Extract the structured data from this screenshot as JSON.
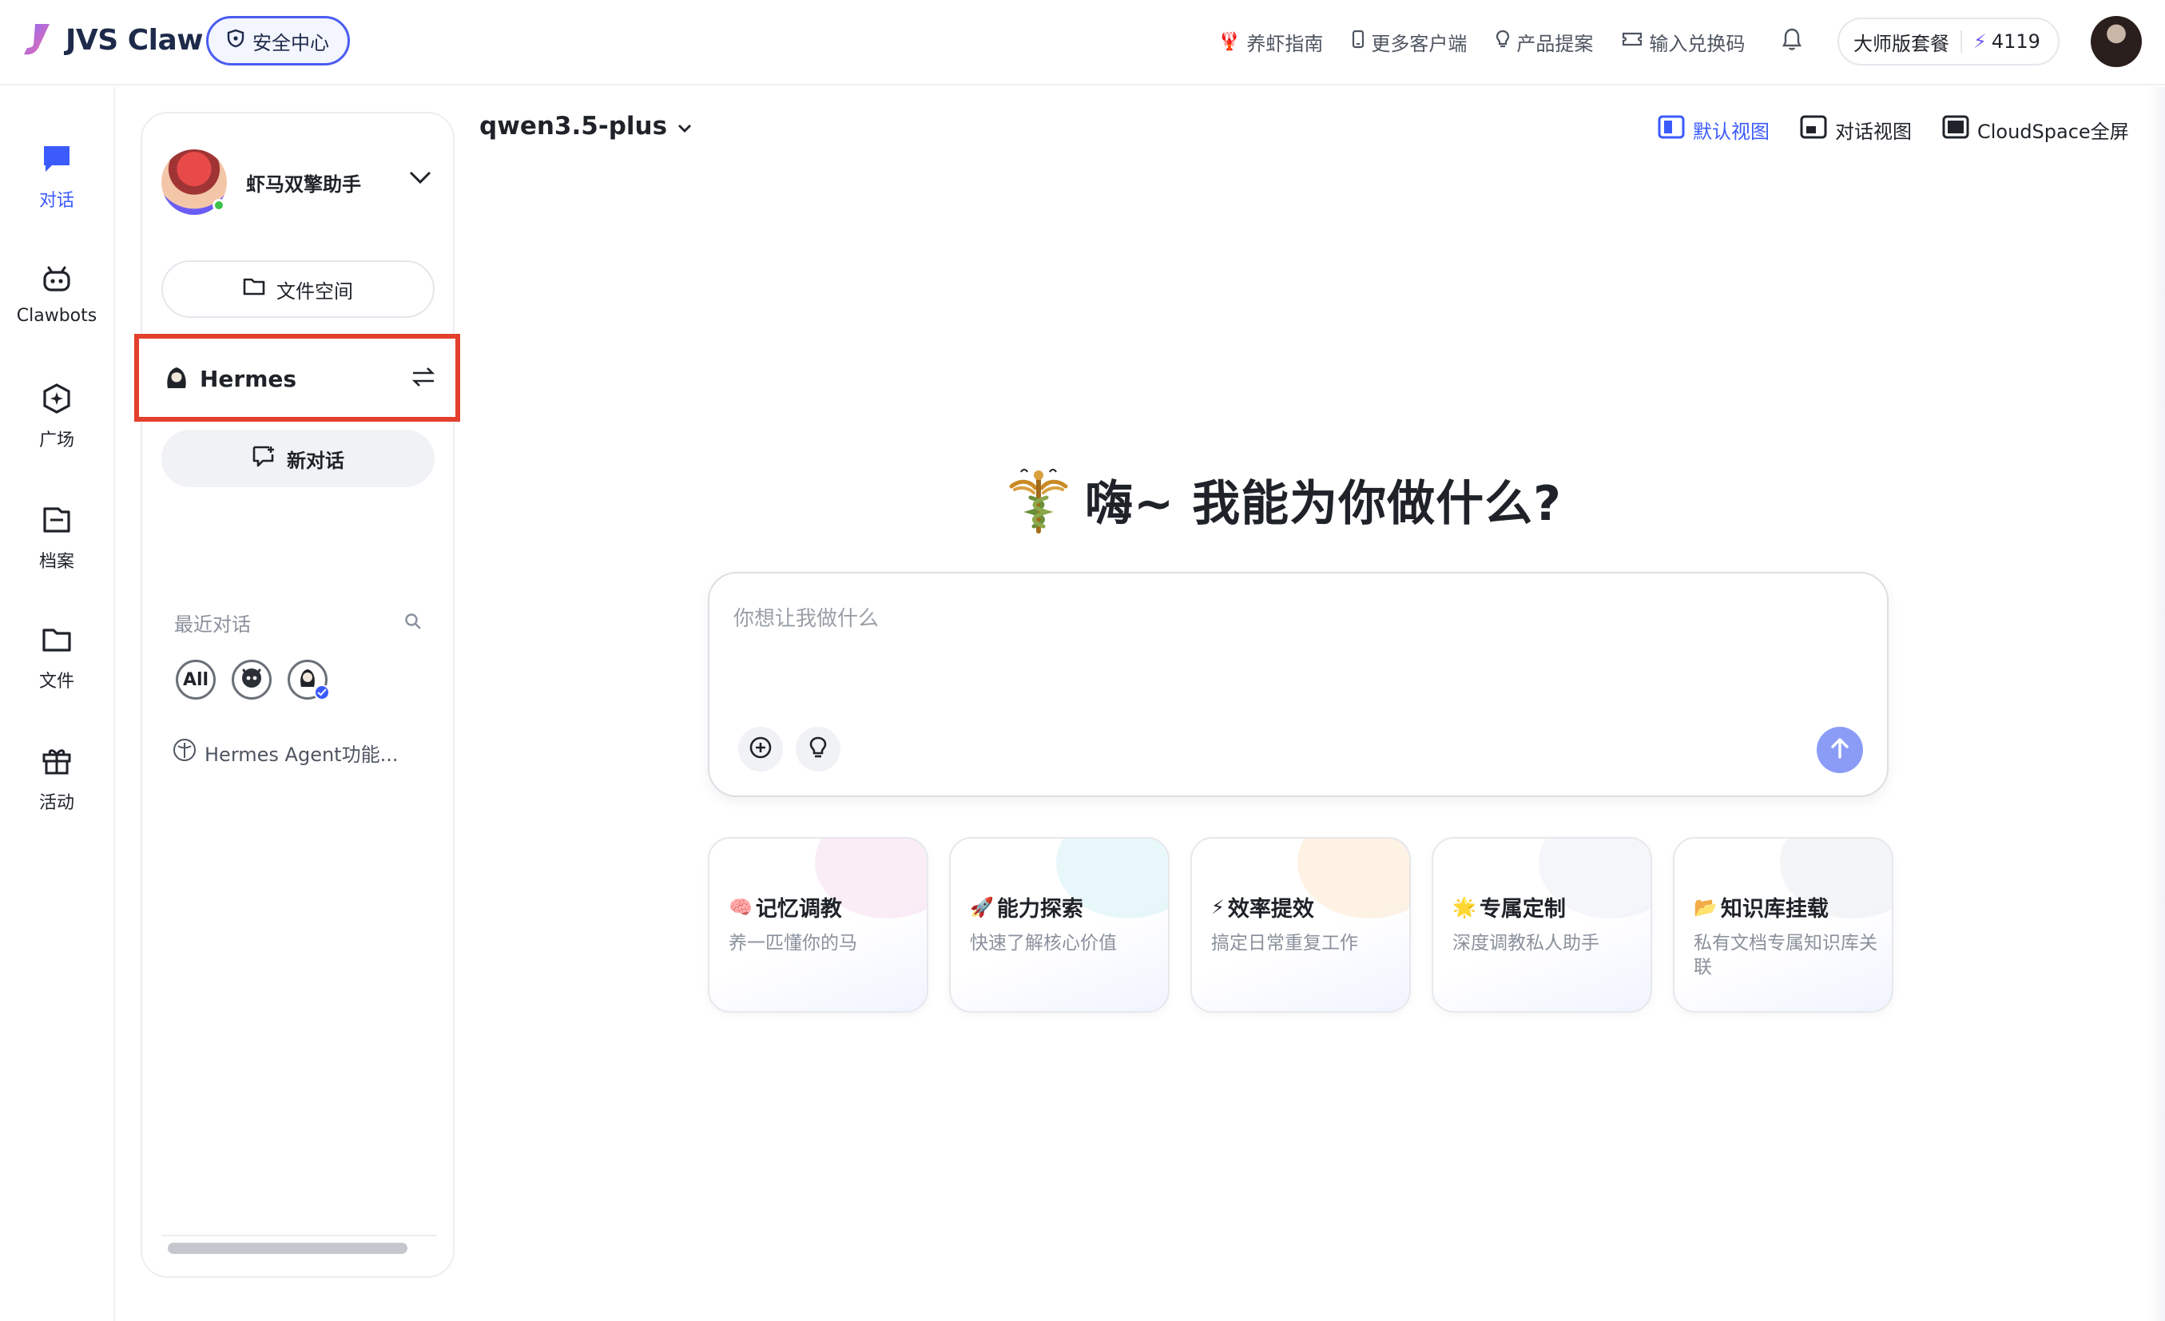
{
  "brand": {
    "name": "JVS Claw",
    "security_label": "安全中心"
  },
  "topbar": {
    "links": [
      {
        "id": "guide",
        "icon": "shrimp-icon",
        "label": "养虾指南"
      },
      {
        "id": "clients",
        "icon": "phone-icon",
        "label": "更多客户端"
      },
      {
        "id": "proposal",
        "icon": "lightbulb-icon",
        "label": "产品提案"
      },
      {
        "id": "redeem",
        "icon": "ticket-icon",
        "label": "输入兑换码"
      }
    ],
    "plan_label": "大师版套餐",
    "credits": "4119"
  },
  "rail": {
    "items": [
      {
        "id": "chat",
        "icon": "chat-bubble-icon",
        "label": "对话",
        "active": true
      },
      {
        "id": "clawbots",
        "icon": "bot-icon",
        "label": "Clawbots",
        "active": false
      },
      {
        "id": "plaza",
        "icon": "compass-icon",
        "label": "广场",
        "active": false
      },
      {
        "id": "archive",
        "icon": "archive-icon",
        "label": "档案",
        "active": false
      },
      {
        "id": "files",
        "icon": "folder-icon",
        "label": "文件",
        "active": false
      },
      {
        "id": "events",
        "icon": "gift-icon",
        "label": "活动",
        "active": false
      }
    ]
  },
  "sidebar": {
    "agent_name": "虾马双擎助手",
    "file_space_label": "文件空间",
    "hermes_label": "Hermes",
    "new_chat_label": "新对话",
    "recent_title": "最近对话",
    "filters": [
      {
        "id": "all",
        "label": "All"
      },
      {
        "id": "claw",
        "label": ""
      },
      {
        "id": "hermes",
        "label": ""
      }
    ],
    "recent_items": [
      {
        "label": "Hermes Agent功能..."
      }
    ]
  },
  "main": {
    "model_name": "qwen3.5-plus",
    "views": [
      {
        "id": "default",
        "label": "默认视图",
        "active": true
      },
      {
        "id": "chat",
        "label": "对话视图",
        "active": false
      },
      {
        "id": "cloudspace",
        "label": "CloudSpace全屏",
        "active": false
      }
    ],
    "greeting": "嗨~ 我能为你做什么?",
    "composer_placeholder": "你想让我做什么",
    "cards": [
      {
        "emoji": "🧠",
        "title": "记忆调教",
        "subtitle": "养一匹懂你的马",
        "glow": "#f5d7ea"
      },
      {
        "emoji": "🚀",
        "title": "能力探索",
        "subtitle": "快速了解核心价值",
        "glow": "#cdeef2"
      },
      {
        "emoji": "⚡",
        "title": "效率提效",
        "subtitle": "搞定日常重复工作",
        "glow": "#fbe3c4"
      },
      {
        "emoji": "🌟",
        "title": "专属定制",
        "subtitle": "深度调教私人助手",
        "glow": "#e9ecf3"
      },
      {
        "emoji": "📂",
        "title": "知识库挂载",
        "subtitle": "私有文档专属知识库关联",
        "glow": "#e5e8ee"
      }
    ]
  },
  "colors": {
    "accent": "#3b5bfd",
    "highlight_border": "#e2402d",
    "send_button": "#8b9cf7"
  }
}
